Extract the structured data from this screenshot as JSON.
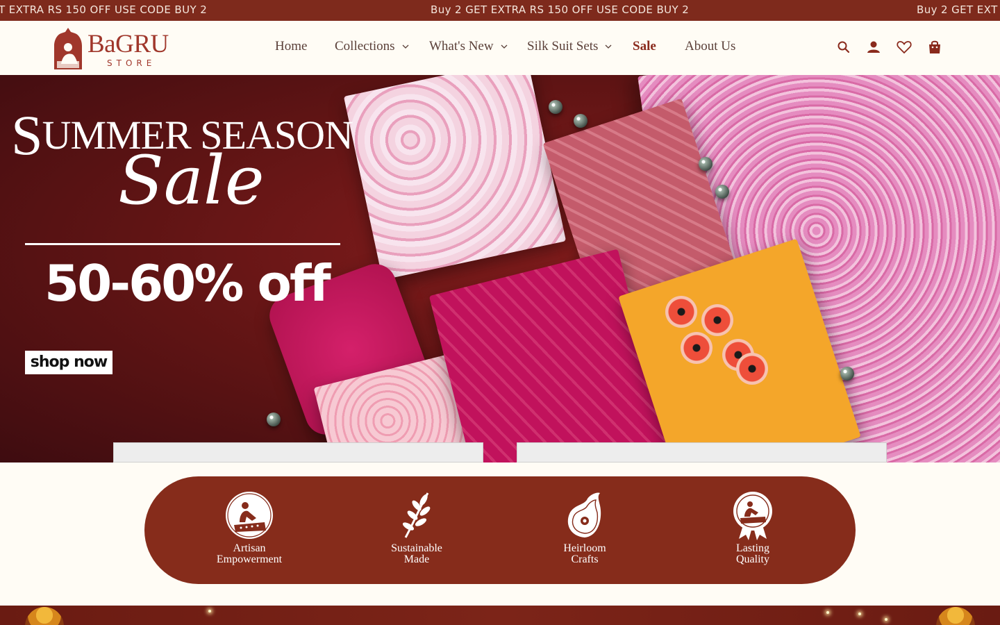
{
  "announcement": {
    "messages": [
      "T EXTRA RS 150 OFF USE CODE BUY 2",
      "Buy 2 GET EXTRA RS 150 OFF USE CODE BUY 2",
      "Buy 2 GET EXT"
    ]
  },
  "brand": {
    "logo_word": "BaGRU",
    "logo_sub": "STORE"
  },
  "nav": {
    "items": [
      {
        "label": "Home",
        "has_dropdown": false
      },
      {
        "label": "Collections",
        "has_dropdown": true
      },
      {
        "label": "What's New",
        "has_dropdown": true
      },
      {
        "label": "Silk Suit Sets",
        "has_dropdown": true
      },
      {
        "label": "Sale",
        "has_dropdown": false
      },
      {
        "label": "About Us",
        "has_dropdown": false
      }
    ]
  },
  "header_icons": [
    "search-icon",
    "account-icon",
    "wishlist-icon",
    "cart-icon"
  ],
  "hero": {
    "title_initial": "S",
    "title_rest": "UMMER SEASON",
    "script": "Sale",
    "offer": "50-60% off",
    "cta": "shop now"
  },
  "features": [
    {
      "icon": "artisan-icon",
      "line1": "Artisan",
      "line2": "Empowerment"
    },
    {
      "icon": "leaf-branch-icon",
      "line1": "Sustainable",
      "line2": "Made"
    },
    {
      "icon": "paisley-icon",
      "line1": "Heirloom",
      "line2": "Crafts"
    },
    {
      "icon": "quality-badge-icon",
      "line1": "Lasting",
      "line2": "Quality"
    }
  ],
  "colors": {
    "brand_maroon": "#7e2a1c",
    "feature_bg": "#862c1b",
    "page_bg": "#fffcf5",
    "sale_link": "#8a2a1c"
  }
}
